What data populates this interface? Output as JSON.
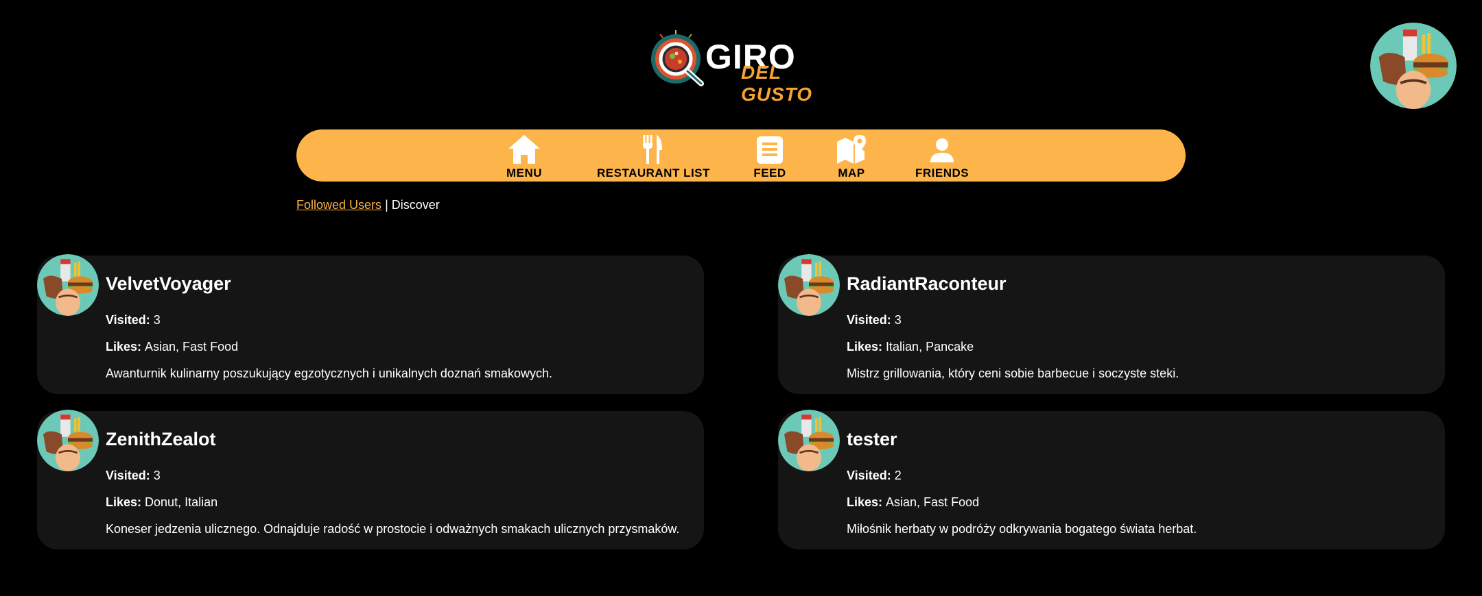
{
  "brand": {
    "line1": "GIRO",
    "line2": "DEL GUSTO"
  },
  "nav": [
    {
      "label": "MENU",
      "icon": "home-icon"
    },
    {
      "label": "RESTAURANT LIST",
      "icon": "fork-knife-icon"
    },
    {
      "label": "FEED",
      "icon": "feed-icon"
    },
    {
      "label": "MAP",
      "icon": "map-pin-icon"
    },
    {
      "label": "FRIENDS",
      "icon": "person-icon"
    }
  ],
  "subnav": {
    "followed": "Followed Users",
    "separator": "|",
    "discover": "Discover"
  },
  "labels": {
    "visited": "Visited:",
    "likes": "Likes:"
  },
  "users": [
    {
      "name": "VelvetVoyager",
      "visited": "3",
      "likes": "Asian, Fast Food",
      "bio": "Awanturnik kulinarny poszukujący egzotycznych i unikalnych doznań smakowych."
    },
    {
      "name": "RadiantRaconteur",
      "visited": "3",
      "likes": "Italian, Pancake",
      "bio": "Mistrz grillowania, który ceni sobie barbecue i soczyste steki."
    },
    {
      "name": "ZenithZealot",
      "visited": "3",
      "likes": "Donut, Italian",
      "bio": "Koneser jedzenia ulicznego. Odnajduje radość w prostocie i odważnych smakach ulicznych przysmaków."
    },
    {
      "name": "tester",
      "visited": "2",
      "likes": "Asian, Fast Food",
      "bio": "Miłośnik herbaty w podróży odkrywania bogatego świata herbat."
    }
  ],
  "colors": {
    "accent": "#fdb54b",
    "card": "#151515",
    "background": "#000000"
  }
}
